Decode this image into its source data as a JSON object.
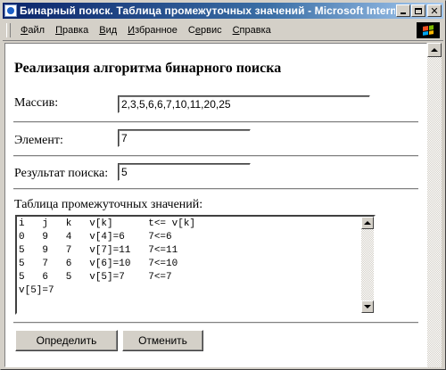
{
  "window": {
    "title": "Бинарный поиск. Таблица промежуточных значений - Microsoft Internet..."
  },
  "menu": {
    "items": [
      {
        "label": "Файл",
        "accel": "Ф"
      },
      {
        "label": "Правка",
        "accel": "П"
      },
      {
        "label": "Вид",
        "accel": "В"
      },
      {
        "label": "Избранное",
        "accel": "И"
      },
      {
        "label": "Сервис",
        "accel": "С"
      },
      {
        "label": "Справка",
        "accel": "С"
      }
    ]
  },
  "page": {
    "heading": "Реализация алгоритма бинарного поиска",
    "array_label": "Массив:",
    "array_value": "2,3,5,6,6,7,10,11,20,25",
    "element_label": "Элемент:",
    "element_value": "7",
    "result_label": "Результат поиска:",
    "result_value": "5",
    "table_label": "Таблица промежуточных значений:",
    "table_text": "i   j   k   v[k]      t<= v[k]\n0   9   4   v[4]=6    7<=6\n5   9   7   v[7]=11   7<=11\n5   7   6   v[6]=10   7<=10\n5   6   5   v[5]=7    7<=7\nv[5]=7",
    "determine_button": "Определить",
    "cancel_button": "Отменить"
  },
  "colors": {
    "titlebar_start": "#0a246a",
    "titlebar_end": "#a6caf0",
    "chrome": "#d4d0c8"
  }
}
